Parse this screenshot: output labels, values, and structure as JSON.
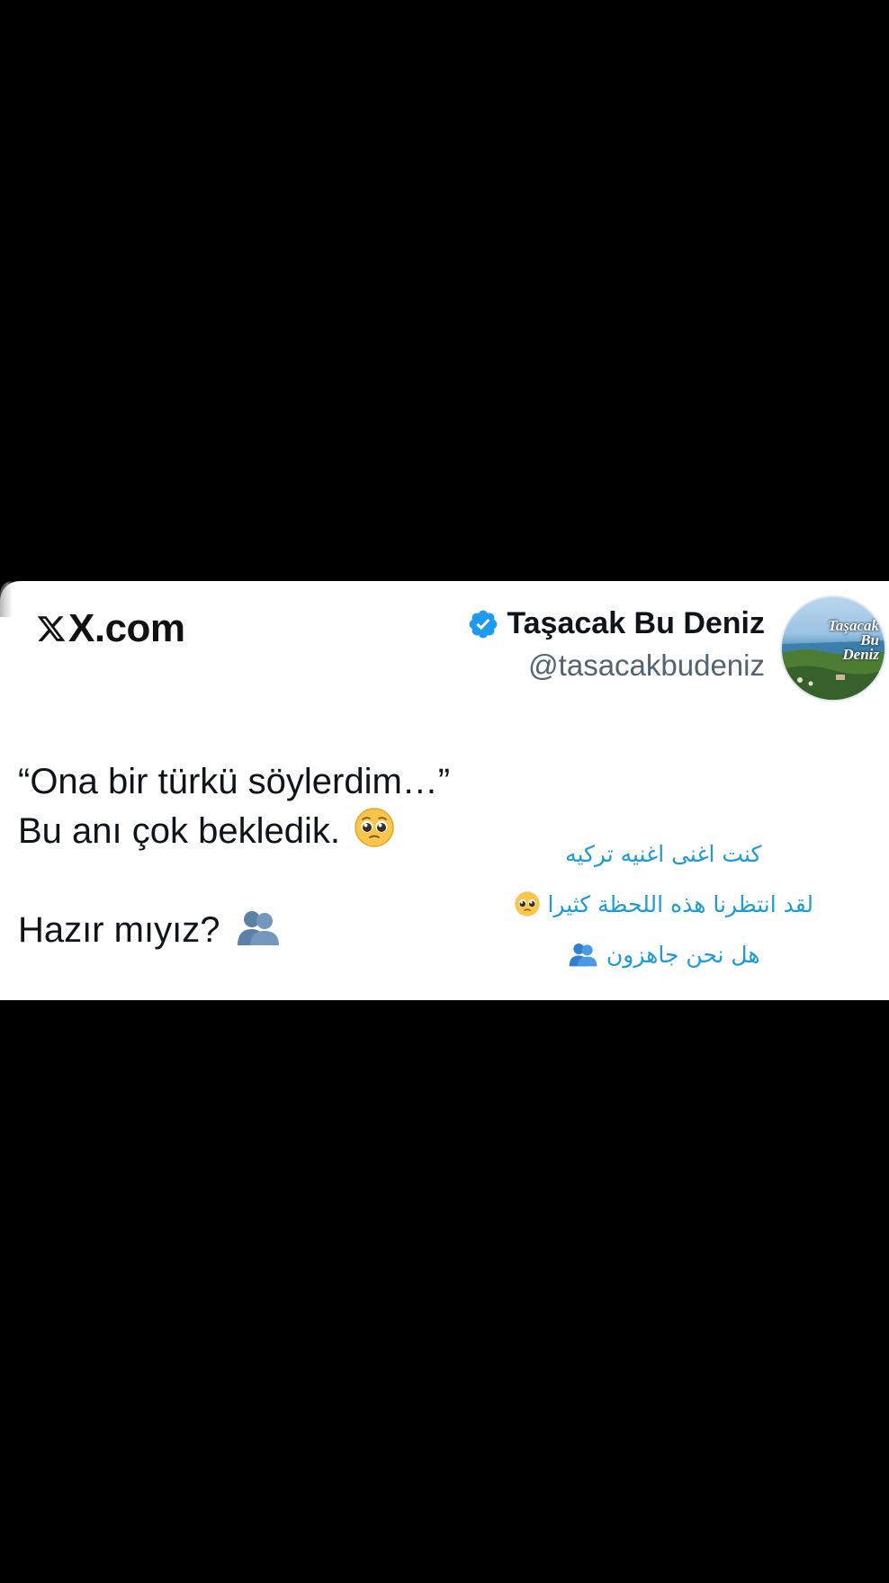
{
  "card": {
    "site": "X.com",
    "author": {
      "display_name": "Taşacak Bu Deniz",
      "handle": "@tasacakbudeniz",
      "verified_icon": "verified-badge-icon",
      "avatar_text": [
        "Taşacak",
        "Bu",
        "Deniz"
      ]
    },
    "tweet": {
      "line1": "“Ona bir türkü söylerdim…”",
      "line2": "Bu anı çok bekledik.",
      "line2_emoji": "pleading-face-emoji",
      "line3": "Hazır mıyız?",
      "line3_emoji": "busts-in-silhouette-emoji"
    },
    "translation": {
      "line1": "كنت اغنى اغنيه تركيه",
      "line2": "لقد انتظرنا هذه اللحظة كثيرا",
      "line2_emoji": "pleading-face-emoji",
      "line3": "هل نحن جاهزون",
      "line3_emoji": "busts-in-silhouette-emoji",
      "color": "#1e9bd6"
    },
    "colors": {
      "verified": "#1d9bf0",
      "handle": "#536471",
      "text": "#0f1419"
    }
  }
}
